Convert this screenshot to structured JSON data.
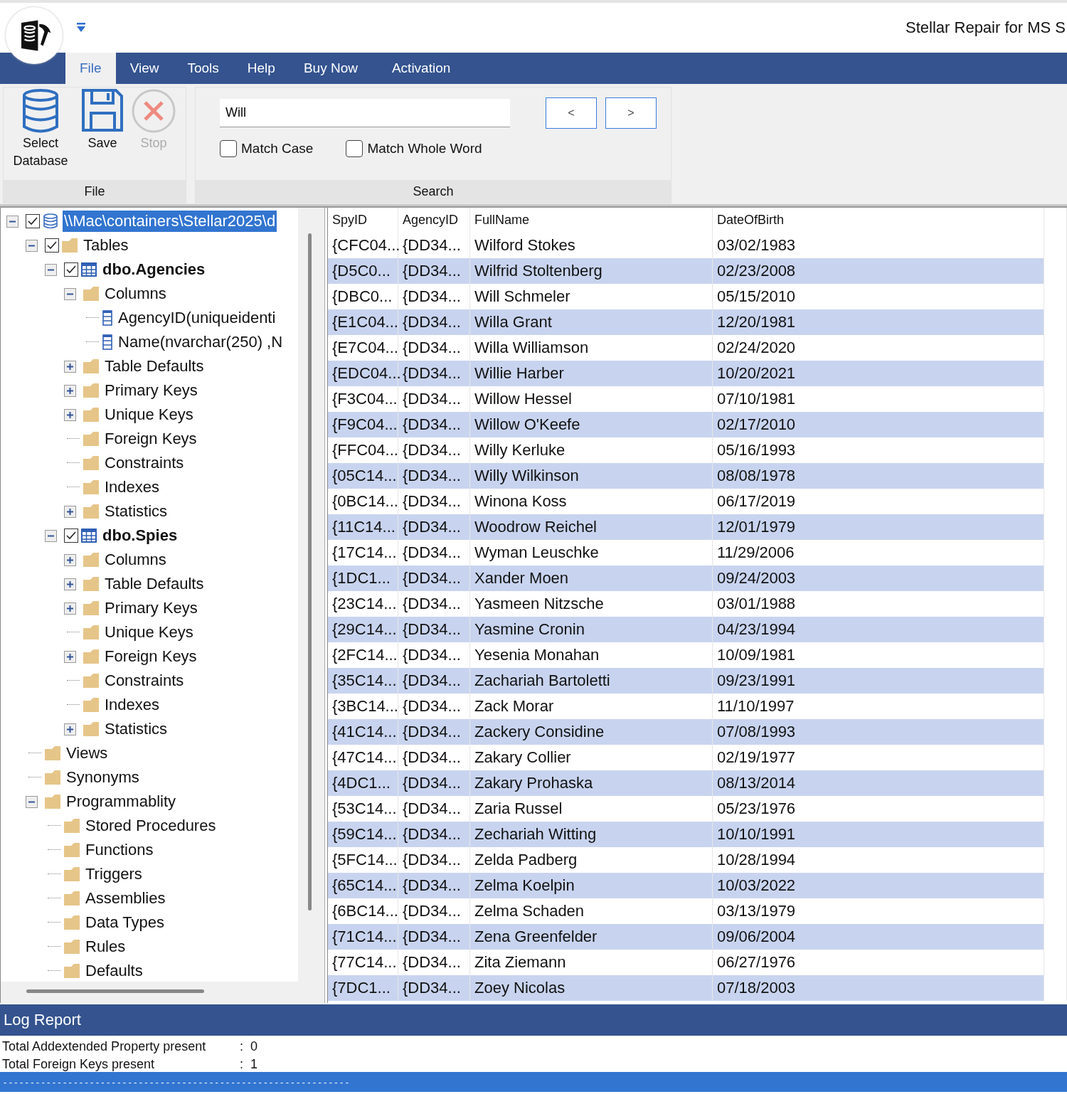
{
  "window": {
    "title": "Stellar Repair for MS S"
  },
  "menu": [
    {
      "label": "File",
      "selected": true
    },
    {
      "label": "View",
      "selected": false
    },
    {
      "label": "Tools",
      "selected": false
    },
    {
      "label": "Help",
      "selected": false
    },
    {
      "label": "Buy Now",
      "selected": false
    },
    {
      "label": "Activation",
      "selected": false
    }
  ],
  "ribbon": {
    "file_group": {
      "label": "File",
      "buttons": [
        {
          "kind": "database",
          "label": "Select Database",
          "disabled": false
        },
        {
          "kind": "save",
          "label": "Save",
          "disabled": false
        },
        {
          "kind": "stop",
          "label": "Stop",
          "disabled": true
        }
      ]
    },
    "search_group": {
      "label": "Search",
      "field": {
        "value": "Will"
      },
      "prev": "<",
      "next": ">",
      "options": [
        {
          "label": "Match Case",
          "checked": false
        },
        {
          "label": "Match Whole Word",
          "checked": false
        }
      ]
    }
  },
  "tree": [
    {
      "kind": "database",
      "label": "\\\\Mac\\containers\\Stellar2025\\d",
      "expanded": true,
      "checked": true,
      "selected": true,
      "children": [
        {
          "kind": "folder",
          "label": "Tables",
          "expanded": true,
          "checked": true,
          "selected": false,
          "children": [
            {
              "kind": "table",
              "label": "dbo.Agencies",
              "expanded": true,
              "checked": true,
              "selected": false,
              "children": [
                {
                  "kind": "folder",
                  "label": "Columns",
                  "expanded": true,
                  "selected": false,
                  "children": [
                    {
                      "kind": "column",
                      "label": "AgencyID(uniqueidenti",
                      "selected": false
                    },
                    {
                      "kind": "column",
                      "label": "Name(nvarchar(250) ,N",
                      "selected": false
                    }
                  ]
                },
                {
                  "kind": "folder",
                  "label": "Table Defaults",
                  "expanded": false,
                  "selected": false
                },
                {
                  "kind": "folder",
                  "label": "Primary Keys",
                  "expanded": false,
                  "selected": false
                },
                {
                  "kind": "folder",
                  "label": "Unique Keys",
                  "expanded": false,
                  "selected": false
                },
                {
                  "kind": "folder",
                  "label": "Foreign Keys",
                  "selected": false
                },
                {
                  "kind": "folder",
                  "label": "Constraints",
                  "selected": false
                },
                {
                  "kind": "folder",
                  "label": "Indexes",
                  "selected": false
                },
                {
                  "kind": "folder",
                  "label": "Statistics",
                  "expanded": false,
                  "selected": false
                }
              ]
            },
            {
              "kind": "table",
              "label": "dbo.Spies",
              "expanded": true,
              "checked": true,
              "selected": false,
              "children": [
                {
                  "kind": "folder",
                  "label": "Columns",
                  "expanded": false,
                  "selected": false
                },
                {
                  "kind": "folder",
                  "label": "Table Defaults",
                  "expanded": false,
                  "selected": false
                },
                {
                  "kind": "folder",
                  "label": "Primary Keys",
                  "expanded": false,
                  "selected": false
                },
                {
                  "kind": "folder",
                  "label": "Unique Keys",
                  "selected": false
                },
                {
                  "kind": "folder",
                  "label": "Foreign Keys",
                  "expanded": false,
                  "selected": false
                },
                {
                  "kind": "folder",
                  "label": "Constraints",
                  "selected": false
                },
                {
                  "kind": "folder",
                  "label": "Indexes",
                  "selected": false
                },
                {
                  "kind": "folder",
                  "label": "Statistics",
                  "expanded": false,
                  "selected": false
                }
              ]
            }
          ]
        },
        {
          "kind": "folder",
          "label": "Views",
          "selected": false
        },
        {
          "kind": "folder",
          "label": "Synonyms",
          "selected": false
        },
        {
          "kind": "folder",
          "label": "Programmablity",
          "expanded": true,
          "selected": false,
          "children": [
            {
              "kind": "folder",
              "label": "Stored Procedures",
              "selected": false
            },
            {
              "kind": "folder",
              "label": "Functions",
              "selected": false
            },
            {
              "kind": "folder",
              "label": "Triggers",
              "selected": false
            },
            {
              "kind": "folder",
              "label": "Assemblies",
              "selected": false
            },
            {
              "kind": "folder",
              "label": "Data Types",
              "selected": false
            },
            {
              "kind": "folder",
              "label": "Rules",
              "selected": false
            },
            {
              "kind": "folder",
              "label": "Defaults",
              "selected": false
            }
          ]
        }
      ]
    }
  ],
  "table": {
    "columns": [
      "SpyID",
      "AgencyID",
      "FullName",
      "DateOfBirth"
    ],
    "rows": [
      [
        "{CFC04...",
        "{DD34...",
        "Wilford Stokes",
        "03/02/1983"
      ],
      [
        "{D5C0...",
        "{DD34...",
        "Wilfrid Stoltenberg",
        "02/23/2008"
      ],
      [
        "{DBC0...",
        "{DD34...",
        "Will Schmeler",
        "05/15/2010"
      ],
      [
        "{E1C04...",
        "{DD34...",
        "Willa Grant",
        "12/20/1981"
      ],
      [
        "{E7C04...",
        "{DD34...",
        "Willa Williamson",
        "02/24/2020"
      ],
      [
        "{EDC04...",
        "{DD34...",
        "Willie Harber",
        "10/20/2021"
      ],
      [
        "{F3C04...",
        "{DD34...",
        "Willow Hessel",
        "07/10/1981"
      ],
      [
        "{F9C04...",
        "{DD34...",
        "Willow O'Keefe",
        "02/17/2010"
      ],
      [
        "{FFC04...",
        "{DD34...",
        "Willy Kerluke",
        "05/16/1993"
      ],
      [
        "{05C14...",
        "{DD34...",
        "Willy Wilkinson",
        "08/08/1978"
      ],
      [
        "{0BC14...",
        "{DD34...",
        "Winona Koss",
        "06/17/2019"
      ],
      [
        "{11C14...",
        "{DD34...",
        "Woodrow Reichel",
        "12/01/1979"
      ],
      [
        "{17C14...",
        "{DD34...",
        "Wyman Leuschke",
        "11/29/2006"
      ],
      [
        "{1DC1...",
        "{DD34...",
        "Xander Moen",
        "09/24/2003"
      ],
      [
        "{23C14...",
        "{DD34...",
        "Yasmeen Nitzsche",
        "03/01/1988"
      ],
      [
        "{29C14...",
        "{DD34...",
        "Yasmine Cronin",
        "04/23/1994"
      ],
      [
        "{2FC14...",
        "{DD34...",
        "Yesenia Monahan",
        "10/09/1981"
      ],
      [
        "{35C14...",
        "{DD34...",
        "Zachariah Bartoletti",
        "09/23/1991"
      ],
      [
        "{3BC14...",
        "{DD34...",
        "Zack Morar",
        "11/10/1997"
      ],
      [
        "{41C14...",
        "{DD34...",
        "Zackery Considine",
        "07/08/1993"
      ],
      [
        "{47C14...",
        "{DD34...",
        "Zakary Collier",
        "02/19/1977"
      ],
      [
        "{4DC1...",
        "{DD34...",
        "Zakary Prohaska",
        "08/13/2014"
      ],
      [
        "{53C14...",
        "{DD34...",
        "Zaria Russel",
        "05/23/1976"
      ],
      [
        "{59C14...",
        "{DD34...",
        "Zechariah Witting",
        "10/10/1991"
      ],
      [
        "{5FC14...",
        "{DD34...",
        "Zelda Padberg",
        "10/28/1994"
      ],
      [
        "{65C14...",
        "{DD34...",
        "Zelma Koelpin",
        "10/03/2022"
      ],
      [
        "{6BC14...",
        "{DD34...",
        "Zelma Schaden",
        "03/13/1979"
      ],
      [
        "{71C14...",
        "{DD34...",
        "Zena Greenfelder",
        "09/06/2004"
      ],
      [
        "{77C14...",
        "{DD34...",
        "Zita Ziemann",
        "06/27/1976"
      ],
      [
        "{7DC1...",
        "{DD34...",
        "Zoey Nicolas",
        "07/18/2003"
      ]
    ]
  },
  "log": {
    "title": "Log Report",
    "lines": [
      {
        "label": "Total Addextended Property present",
        "value": ":  0"
      },
      {
        "label": "Total Foreign Keys present",
        "value": ":  1"
      }
    ],
    "footer": "----------------------------------------------------------------"
  }
}
